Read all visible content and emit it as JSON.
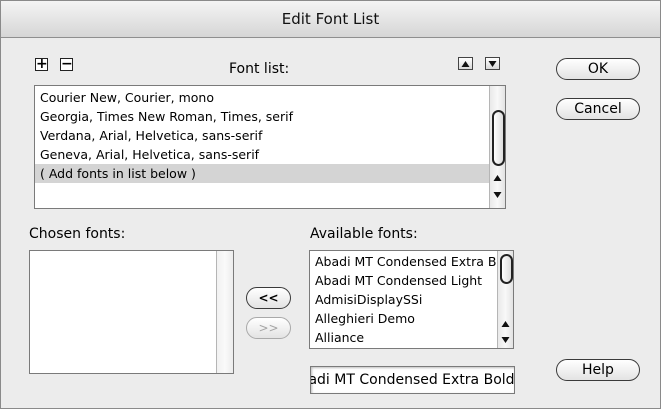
{
  "window": {
    "title": "Edit Font List"
  },
  "font_list": {
    "label": "Font list:",
    "items": [
      "Courier New, Courier, mono",
      "Georgia, Times New Roman, Times, serif",
      "Verdana, Arial, Helvetica, sans-serif",
      "Geneva, Arial, Helvetica, sans-serif",
      "( Add fonts in list below )"
    ],
    "selected_index": 4
  },
  "toolbar": {
    "add_glyph": "+",
    "remove_glyph": "−"
  },
  "chosen_fonts": {
    "label": "Chosen fonts:",
    "items": []
  },
  "available_fonts": {
    "label": "Available fonts:",
    "items": [
      "Abadi MT Condensed Extra Bold",
      "Abadi MT Condensed Light",
      "AdmisiDisplaySSi",
      "Alleghieri Demo",
      "Alliance"
    ],
    "field_value": "Abadi MT Condensed Extra Bold"
  },
  "transfer": {
    "add_label": "<<",
    "remove_label": ">>"
  },
  "buttons": {
    "ok": "OK",
    "cancel": "Cancel",
    "help": "Help"
  },
  "icons": {
    "add": "plus-icon",
    "remove": "minus-icon",
    "move_up": "triangle-up-icon",
    "move_down": "triangle-down-icon"
  }
}
